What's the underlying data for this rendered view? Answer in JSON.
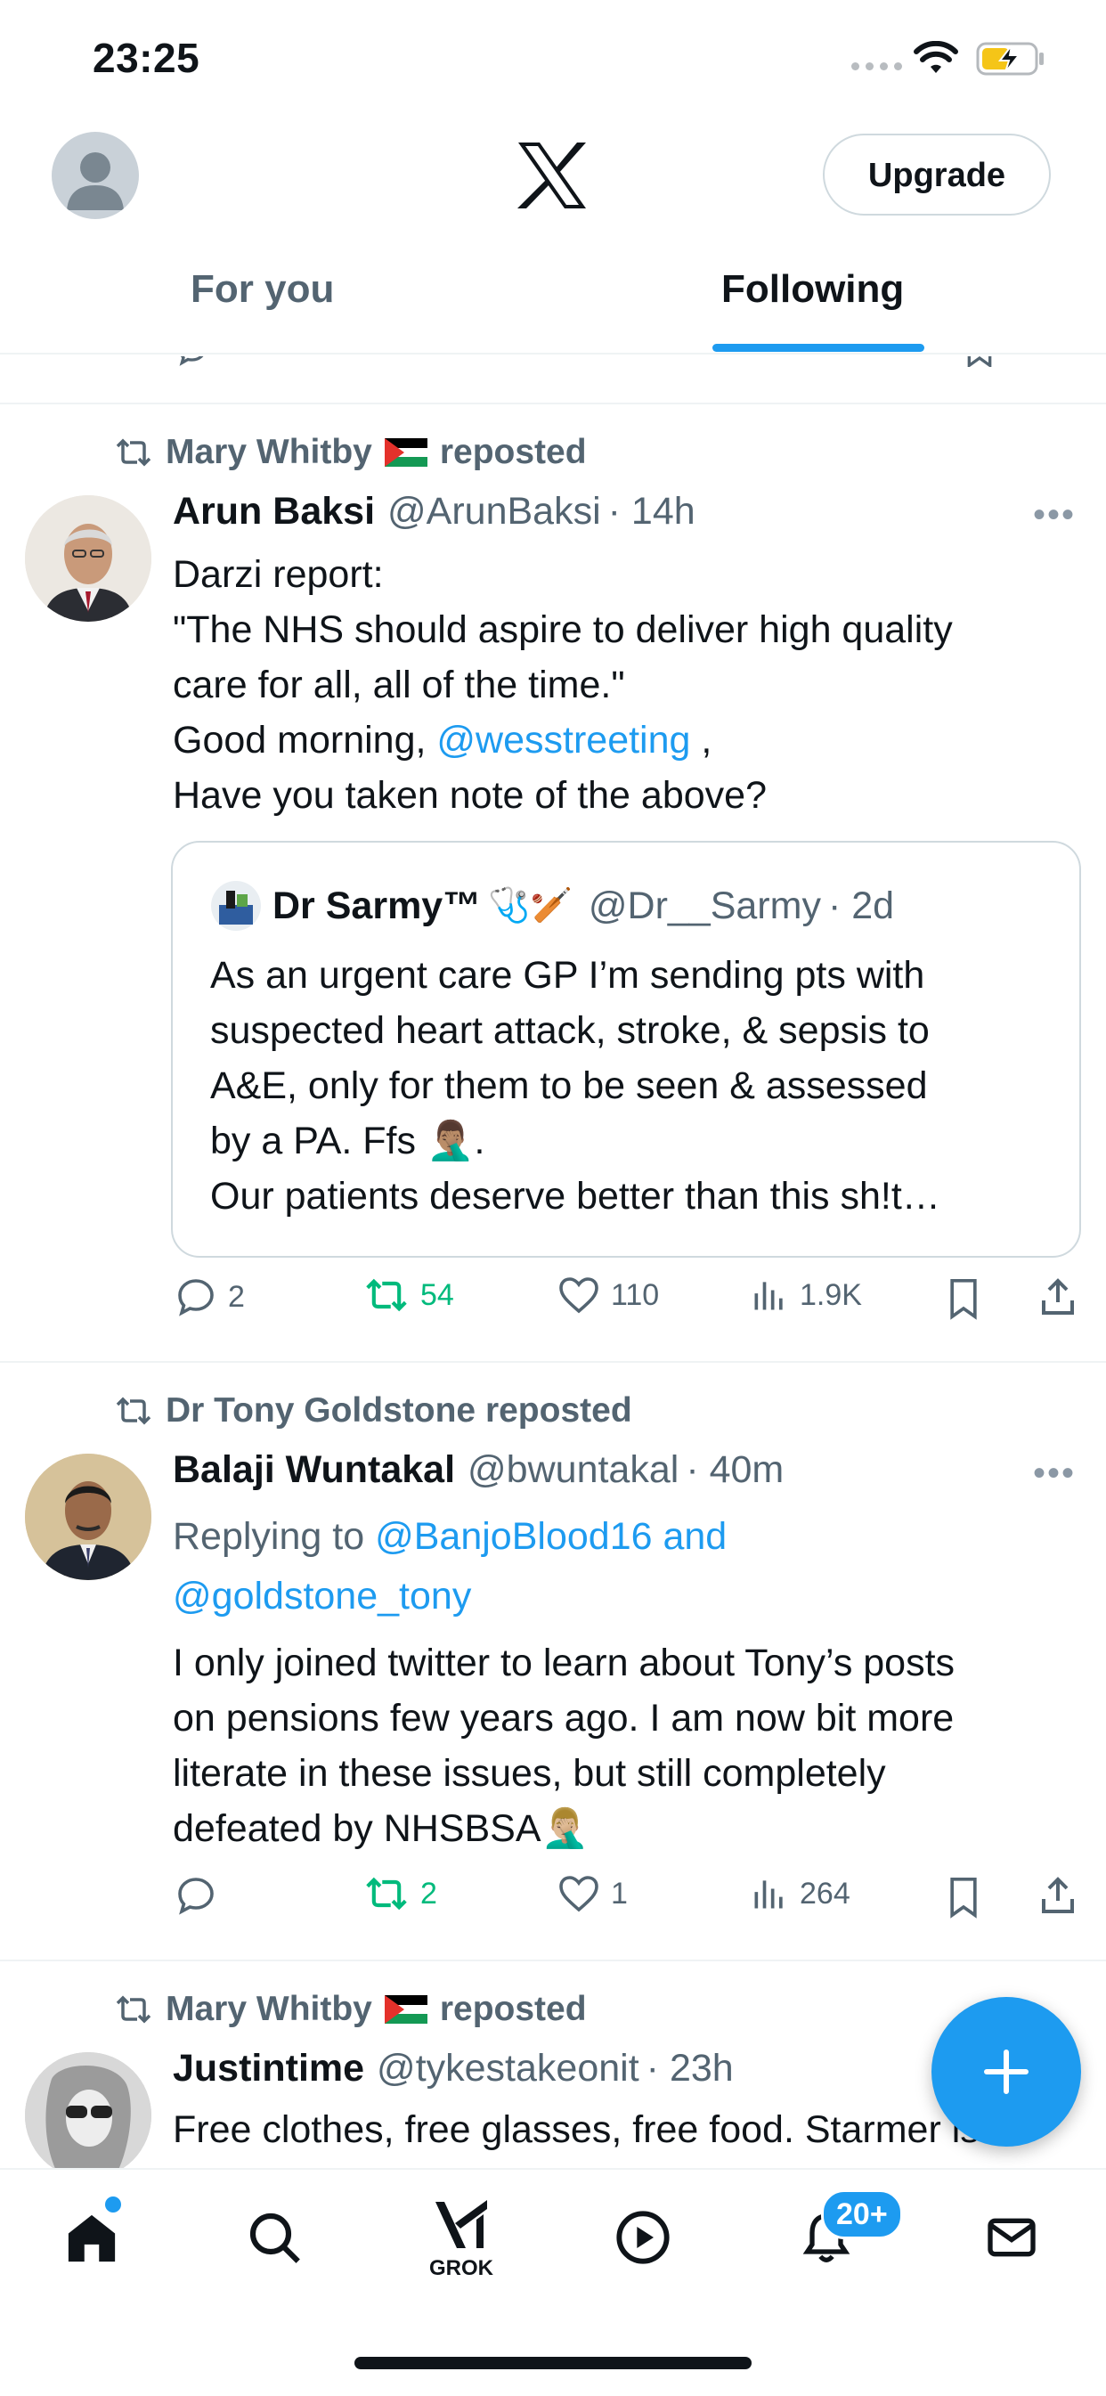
{
  "status_bar": {
    "time": "23:25"
  },
  "header": {
    "logo": "x-logo",
    "upgrade_label": "Upgrade"
  },
  "tabs": [
    {
      "label": "For you"
    },
    {
      "label": "Following"
    }
  ],
  "tweets": [
    {
      "repost_by": "Mary Whitby",
      "repost_suffix": "reposted",
      "name": "Arun Baksi",
      "handle": "@ArunBaksi",
      "time": "· 14h",
      "body": [
        "Darzi report:",
        "\"The NHS should aspire to deliver high quality",
        "care for all, all of the time.\"",
        "Good morning,",
        "@wesstreeting",
        ",",
        "Have you taken note of the above?"
      ],
      "quote": {
        "name": "Dr Sarmy™",
        "name_emoji": "🩺🏏",
        "handle": "@Dr__Sarmy",
        "time": "· 2d",
        "body": [
          "As an urgent care GP I’m sending pts with",
          "suspected heart attack, stroke, & sepsis to",
          "A&E, only for them to be seen & assessed",
          "by a PA. Ffs",
          "🤦🏽‍♂️",
          ".",
          "Our patients deserve better than this sh!t…"
        ]
      },
      "stats": {
        "replies": "2",
        "reposts": "54",
        "likes": "110",
        "views": "1.9K"
      }
    },
    {
      "repost_by": "Dr Tony Goldstone reposted",
      "name": "Balaji Wuntakal",
      "handle": "@bwuntakal",
      "time": "· 40m",
      "replying_prefix": "Replying to",
      "replying_to_1": "@BanjoBlood16 and",
      "replying_to_2": "@goldstone_tony",
      "body": [
        "I only joined twitter to learn about Tony’s posts",
        "on pensions few years ago. I am now bit more",
        "literate in these issues, but still completely",
        "defeated by NHSBSA",
        "🤦🏼‍♂️"
      ],
      "stats": {
        "replies": "",
        "reposts": "2",
        "likes": "1",
        "views": "264"
      }
    },
    {
      "repost_by": "Mary Whitby",
      "repost_suffix": "reposted",
      "name": "Justintime",
      "handle": "@tykestakeonit",
      "time": "· 23h",
      "body": [
        "Free clothes, free glasses, free food. Starmer is"
      ]
    }
  ],
  "nav": {
    "grok_label": "GROK",
    "notifications_badge": "20+"
  },
  "colors": {
    "accent": "#1d9bf0",
    "repost_green": "#00ba7c",
    "muted": "#536471"
  }
}
